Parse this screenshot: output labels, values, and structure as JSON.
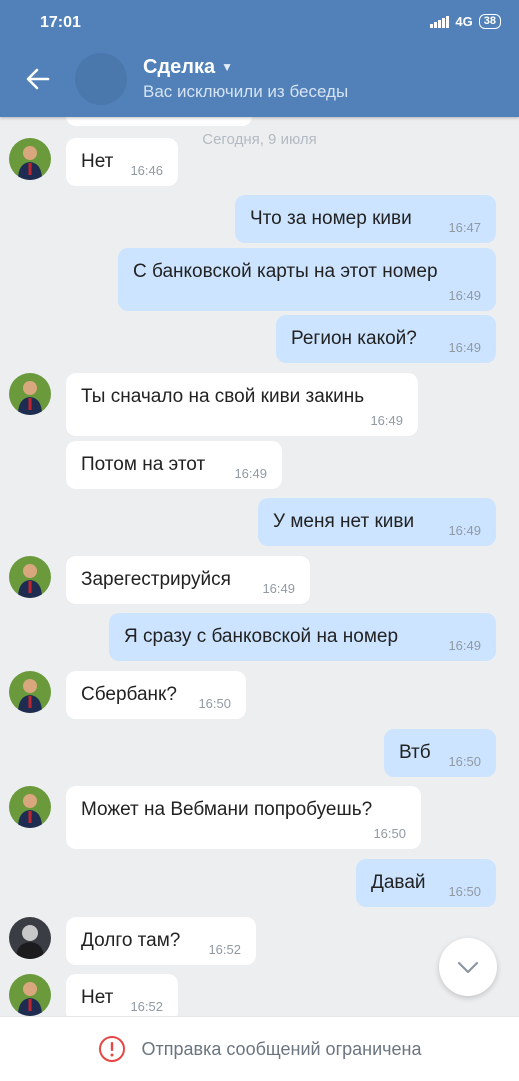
{
  "status_bar": {
    "time": "17:01",
    "network": "4G",
    "battery": "38"
  },
  "header": {
    "title": "Сделка",
    "subtitle": "Вас исключили из беседы"
  },
  "date_separator": "Сегодня, 9 июля",
  "messages": [
    {
      "text": "Нет",
      "time": "16:46"
    },
    {
      "text": "Что за номер киви",
      "time": "16:47"
    },
    {
      "text": "С банковской карты на этот номер",
      "time": "16:49"
    },
    {
      "text": "Регион какой?",
      "time": "16:49"
    },
    {
      "text": "Ты сначало на свой киви закинь",
      "time": "16:49"
    },
    {
      "text": "Потом на этот",
      "time": "16:49"
    },
    {
      "text": "У меня нет киви",
      "time": "16:49"
    },
    {
      "text": "Зарегестрируйся",
      "time": "16:49"
    },
    {
      "text": "Я сразу с банковской на номер",
      "time": "16:49"
    },
    {
      "text": "Сбербанк?",
      "time": "16:50"
    },
    {
      "text": "Втб",
      "time": "16:50"
    },
    {
      "text": "Может на Вебмани попробуешь?",
      "time": "16:50"
    },
    {
      "text": "Давай",
      "time": "16:50"
    },
    {
      "text": "Долго там?",
      "time": "16:52"
    },
    {
      "text": "Нет",
      "time": "16:52"
    }
  ],
  "footer": {
    "text": "Отправка сообщений ограничена"
  },
  "colors": {
    "header": "#5181b8",
    "incoming": "#ffffff",
    "outgoing": "#cce4ff",
    "warning": "#e64646"
  }
}
